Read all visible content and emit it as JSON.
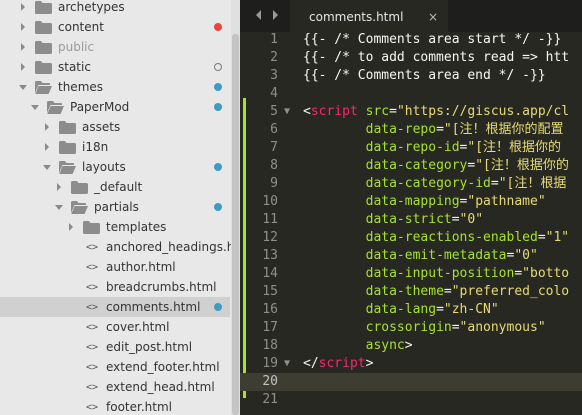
{
  "sidebar": {
    "items": [
      {
        "label": "archetypes",
        "kind": "folder",
        "depth": 0,
        "expanded": false,
        "dot": ""
      },
      {
        "label": "content",
        "kind": "folder",
        "depth": 0,
        "expanded": false,
        "dot": "#e8453c"
      },
      {
        "label": "public",
        "kind": "folder",
        "depth": 0,
        "expanded": false,
        "dot": "",
        "dim": true
      },
      {
        "label": "static",
        "kind": "folder",
        "depth": 0,
        "expanded": false,
        "dot": "ring"
      },
      {
        "label": "themes",
        "kind": "folder",
        "depth": 0,
        "expanded": true,
        "dot": "#3d9cc3"
      },
      {
        "label": "PaperMod",
        "kind": "folder",
        "depth": 1,
        "expanded": true,
        "dot": "#3d9cc3"
      },
      {
        "label": "assets",
        "kind": "folder",
        "depth": 2,
        "expanded": false,
        "dot": ""
      },
      {
        "label": "i18n",
        "kind": "folder",
        "depth": 2,
        "expanded": false,
        "dot": ""
      },
      {
        "label": "layouts",
        "kind": "folder",
        "depth": 2,
        "expanded": true,
        "dot": "#3d9cc3"
      },
      {
        "label": "_default",
        "kind": "folder",
        "depth": 3,
        "expanded": false,
        "dot": ""
      },
      {
        "label": "partials",
        "kind": "folder",
        "depth": 3,
        "expanded": true,
        "dot": "#3d9cc3"
      },
      {
        "label": "templates",
        "kind": "folder",
        "depth": 4,
        "expanded": false,
        "dot": ""
      },
      {
        "label": "anchored_headings.html",
        "kind": "file",
        "depth": 4,
        "dot": ""
      },
      {
        "label": "author.html",
        "kind": "file",
        "depth": 4,
        "dot": ""
      },
      {
        "label": "breadcrumbs.html",
        "kind": "file",
        "depth": 4,
        "dot": ""
      },
      {
        "label": "comments.html",
        "kind": "file",
        "depth": 4,
        "dot": "#3d9cc3",
        "selected": true
      },
      {
        "label": "cover.html",
        "kind": "file",
        "depth": 4,
        "dot": ""
      },
      {
        "label": "edit_post.html",
        "kind": "file",
        "depth": 4,
        "dot": ""
      },
      {
        "label": "extend_footer.html",
        "kind": "file",
        "depth": 4,
        "dot": ""
      },
      {
        "label": "extend_head.html",
        "kind": "file",
        "depth": 4,
        "dot": ""
      },
      {
        "label": "footer.html",
        "kind": "file",
        "depth": 4,
        "dot": ""
      }
    ]
  },
  "tabbar": {
    "back_icon": "chevron-left-icon",
    "forward_icon": "chevron-right-icon",
    "tab_label": "comments.html",
    "close_glyph": "×"
  },
  "editor": {
    "current_line": 20,
    "folded_lines": [
      5,
      19
    ],
    "lines": [
      [
        [
          "plain",
          "{{- /* Comments area start */ -}}"
        ]
      ],
      [
        [
          "plain",
          "{{- /* to add comments read => htt"
        ]
      ],
      [
        [
          "plain",
          "{{- /* Comments area end */ -}}"
        ]
      ],
      [],
      [
        [
          "plain",
          "<"
        ],
        [
          "tag",
          "script"
        ],
        [
          "plain",
          " "
        ],
        [
          "attr",
          "src"
        ],
        [
          "plain",
          "="
        ],
        [
          "str",
          "\"https://giscus.app/cl"
        ]
      ],
      [
        [
          "plain",
          "        "
        ],
        [
          "attr",
          "data-repo"
        ],
        [
          "plain",
          "="
        ],
        [
          "str",
          "\"[注！根据你的配置"
        ]
      ],
      [
        [
          "plain",
          "        "
        ],
        [
          "attr",
          "data-repo-id"
        ],
        [
          "plain",
          "="
        ],
        [
          "str",
          "\"[注！根据你的"
        ]
      ],
      [
        [
          "plain",
          "        "
        ],
        [
          "attr",
          "data-category"
        ],
        [
          "plain",
          "="
        ],
        [
          "str",
          "\"[注！根据你的"
        ]
      ],
      [
        [
          "plain",
          "        "
        ],
        [
          "attr",
          "data-category-id"
        ],
        [
          "plain",
          "="
        ],
        [
          "str",
          "\"[注！根据"
        ]
      ],
      [
        [
          "plain",
          "        "
        ],
        [
          "attr",
          "data-mapping"
        ],
        [
          "plain",
          "="
        ],
        [
          "str",
          "\"pathname\""
        ]
      ],
      [
        [
          "plain",
          "        "
        ],
        [
          "attr",
          "data-strict"
        ],
        [
          "plain",
          "="
        ],
        [
          "str",
          "\"0\""
        ]
      ],
      [
        [
          "plain",
          "        "
        ],
        [
          "attr",
          "data-reactions-enabled"
        ],
        [
          "plain",
          "="
        ],
        [
          "str",
          "\"1\""
        ]
      ],
      [
        [
          "plain",
          "        "
        ],
        [
          "attr",
          "data-emit-metadata"
        ],
        [
          "plain",
          "="
        ],
        [
          "str",
          "\"0\""
        ]
      ],
      [
        [
          "plain",
          "        "
        ],
        [
          "attr",
          "data-input-position"
        ],
        [
          "plain",
          "="
        ],
        [
          "str",
          "\"botto"
        ]
      ],
      [
        [
          "plain",
          "        "
        ],
        [
          "attr",
          "data-theme"
        ],
        [
          "plain",
          "="
        ],
        [
          "str",
          "\"preferred_colo"
        ]
      ],
      [
        [
          "plain",
          "        "
        ],
        [
          "attr",
          "data-lang"
        ],
        [
          "plain",
          "="
        ],
        [
          "str",
          "\"zh-CN\""
        ]
      ],
      [
        [
          "plain",
          "        "
        ],
        [
          "attr",
          "crossorigin"
        ],
        [
          "plain",
          "="
        ],
        [
          "str",
          "\"anonymous\""
        ]
      ],
      [
        [
          "plain",
          "        "
        ],
        [
          "attr",
          "async"
        ],
        [
          "plain",
          ">"
        ]
      ],
      [
        [
          "plain",
          "</"
        ],
        [
          "tag",
          "script"
        ],
        [
          "plain",
          ">"
        ]
      ],
      [],
      []
    ]
  },
  "colors": {
    "sidebar_bg": "#e8e8e8",
    "editor_bg": "#272822",
    "tag": "#f92672",
    "attr": "#a6e22e",
    "string": "#e6db74",
    "dot_red": "#e8453c",
    "dot_blue": "#3d9cc3"
  }
}
